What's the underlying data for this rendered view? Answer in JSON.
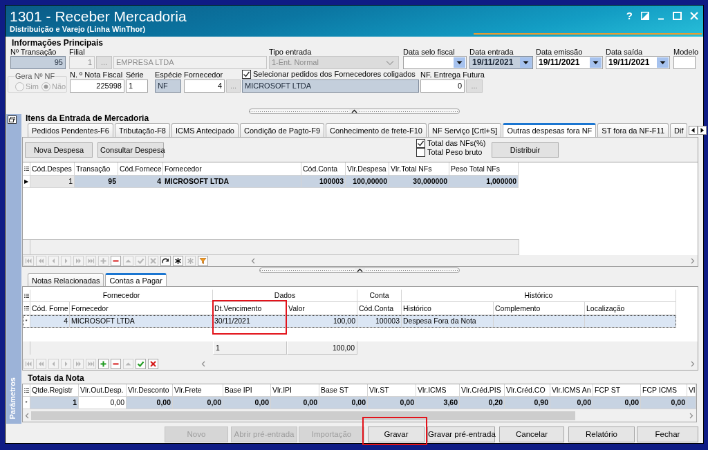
{
  "window": {
    "title": "1301 - Receber Mercadoria",
    "subtitle": "Distribuição e Varejo (Linha WinThor)",
    "help": "?"
  },
  "main_info": {
    "title": "Informações Principais",
    "row_1": [
      {
        "kind": "number",
        "label": "Nº Transação",
        "value": "95",
        "readonly": true,
        "disabled": false
      },
      {
        "kind": "lookup",
        "label": "Filial",
        "code": "1",
        "button": "...",
        "name": "EMPRESA LTDA",
        "readonly": false,
        "disabled": true
      },
      {
        "kind": "combo",
        "label": "Tipo entrada",
        "value": "1-Ent. Normal",
        "readonly": false,
        "disabled": true
      },
      {
        "kind": "date",
        "label": "Data selo fiscal",
        "readonly": false,
        "disabled": false
      },
      {
        "kind": "date",
        "label": "Data entrada",
        "value": "19/11/2021",
        "readonly": true,
        "disabled": false
      },
      {
        "kind": "date",
        "label": "Data emissão",
        "value": "19/11/2021",
        "readonly": false,
        "disabled": false
      },
      {
        "kind": "date",
        "label": "Data saída",
        "value": "19/11/2021",
        "readonly": false,
        "disabled": false
      },
      {
        "kind": "text",
        "label": "Modelo",
        "readonly": false,
        "disabled": false
      }
    ],
    "row_2": [
      {
        "kind": "radio_group",
        "label": "Gera Nº NF",
        "disabled": true,
        "options": [
          {
            "label": "Sim",
            "selected": false
          },
          {
            "label": "Não",
            "selected": true
          }
        ]
      },
      {
        "kind": "number",
        "label": "N. º Nota Fiscal",
        "value": "225998",
        "readonly": false,
        "disabled": false
      },
      {
        "kind": "text",
        "label": "Série",
        "value": "1",
        "readonly": false,
        "disabled": false
      },
      {
        "kind": "text",
        "label": "Espécie",
        "value": "NF",
        "readonly": true,
        "disabled": false
      },
      {
        "kind": "lookup",
        "label": "Fornecedor",
        "code": "4",
        "button": "...",
        "name": "MICROSOFT LTDA",
        "readonly": true,
        "disabled": false,
        "name_option": {
          "label": "Selecionar pedidos dos Fornecedores coligados",
          "checked": true
        }
      },
      {
        "kind": "lookup",
        "label": "NF. Entrega Futura",
        "code": "0",
        "button": "...",
        "disabled": false
      }
    ]
  },
  "side_panel": {
    "label": "Parâmetros"
  },
  "items": {
    "title": "Itens da Entrada de Mercadoria",
    "tabs": [
      {
        "label": "Pedidos Pendentes-F6",
        "selected": false
      },
      {
        "label": "Tributação-F8",
        "selected": false
      },
      {
        "label": "ICMS Antecipado",
        "selected": false
      },
      {
        "label": "Condição de Pagto-F9",
        "selected": false
      },
      {
        "label": "Conhecimento de frete-F10",
        "selected": false
      },
      {
        "label": "NF Serviço [Crtl+S]",
        "selected": false
      },
      {
        "label": "Outras despesas fora NF",
        "selected": true
      },
      {
        "label": "ST fora da NF-F11",
        "selected": false
      },
      {
        "label": "Dif",
        "selected": false
      }
    ],
    "actions": [
      "Nova Despesa",
      "Consultar Despesa"
    ],
    "options": [
      {
        "label": "Total das NFs(%)",
        "checked": true
      },
      {
        "label": "Total Peso bruto",
        "checked": false
      }
    ],
    "distribute_button": "Distribuir",
    "grid": {
      "columns": [
        {
          "label": "Cód.Despes",
          "kind": "number",
          "focused": true
        },
        {
          "label": "Transação",
          "kind": "number",
          "focused": false
        },
        {
          "label": "Cód.Fornece",
          "kind": "number",
          "focused": false
        },
        {
          "label": "Fornecedor",
          "kind": "text",
          "focused": false
        },
        {
          "label": "Cód.Conta",
          "kind": "number",
          "focused": false
        },
        {
          "label": "Vlr.Despesa",
          "kind": "number",
          "focused": false
        },
        {
          "label": "Vlr.Total NFs",
          "kind": "number",
          "focused": false
        },
        {
          "label": "Peso Total NFs",
          "kind": "number",
          "focused": false
        }
      ],
      "rows": [
        {
          "indicator": "▶",
          "selected": true,
          "cells": [
            "1",
            "95",
            "4",
            "MICROSOFT LTDA",
            "100003",
            "100,00000",
            "30,000000",
            "1,000000"
          ]
        }
      ]
    },
    "navigator": [
      {
        "kind": "first",
        "disabled": true
      },
      {
        "kind": "prev_page",
        "disabled": true
      },
      {
        "kind": "prev",
        "disabled": true
      },
      {
        "kind": "next",
        "disabled": true
      },
      {
        "kind": "next_page",
        "disabled": true
      },
      {
        "kind": "last",
        "disabled": true
      },
      {
        "kind": "insert",
        "disabled": true
      },
      {
        "kind": "delete",
        "disabled": false
      },
      {
        "kind": "edit",
        "disabled": true
      },
      {
        "kind": "post",
        "disabled": true
      },
      {
        "kind": "cancel",
        "disabled": true
      },
      {
        "kind": "refresh",
        "disabled": false
      },
      {
        "kind": "asterisk",
        "disabled": false
      },
      {
        "kind": "asterisk",
        "disabled": true
      },
      {
        "kind": "filter",
        "disabled": false
      }
    ]
  },
  "payables": {
    "tabs": [
      {
        "label": "Notas Relacionadas",
        "selected": false
      },
      {
        "label": "Contas a Pagar",
        "selected": true
      }
    ],
    "grid": {
      "bands": [
        {
          "label": "Fornecedor",
          "columns": [
            {
              "label": "Cód. Forne",
              "kind": "number",
              "highlighted": false
            },
            {
              "label": "Fornecedor",
              "kind": "text",
              "highlighted": false
            }
          ]
        },
        {
          "label": "Dados",
          "columns": [
            {
              "label": "Dt.Vencimento",
              "kind": "text",
              "highlighted": true,
              "summary": "1"
            },
            {
              "label": "Valor",
              "kind": "number",
              "highlighted": false,
              "summary": "100,00"
            }
          ]
        },
        {
          "label": "Conta",
          "columns": [
            {
              "label": "Cód.Conta",
              "kind": "number",
              "highlighted": false
            }
          ]
        },
        {
          "label": "Histórico",
          "columns": [
            {
              "label": "Histórico",
              "kind": "text",
              "highlighted": false
            },
            {
              "label": "Complemento",
              "kind": "text",
              "highlighted": false
            },
            {
              "label": "Localização",
              "kind": "text",
              "highlighted": false
            }
          ]
        }
      ],
      "rows": [
        {
          "indicator": "*",
          "selected": true,
          "cells": [
            "4",
            "MICROSOFT LTDA",
            "30/11/2021",
            "100,00",
            "100003",
            "Despesa Fora da Nota",
            null,
            null
          ]
        }
      ]
    },
    "navigator": [
      {
        "kind": "first",
        "disabled": true
      },
      {
        "kind": "prev_page",
        "disabled": true
      },
      {
        "kind": "prev",
        "disabled": true
      },
      {
        "kind": "next",
        "disabled": true
      },
      {
        "kind": "next_page",
        "disabled": true
      },
      {
        "kind": "last",
        "disabled": true
      },
      {
        "kind": "insert",
        "disabled": false
      },
      {
        "kind": "delete",
        "disabled": false
      },
      {
        "kind": "edit",
        "disabled": true
      },
      {
        "kind": "post",
        "disabled": false
      },
      {
        "kind": "cancel",
        "disabled": false
      }
    ]
  },
  "totals": {
    "title": "Totais da Nota",
    "grid": {
      "columns": [
        {
          "label": "Qtde.Registr",
          "kind": "number",
          "focused": false
        },
        {
          "label": "Vlr.Out.Desp.",
          "kind": "number",
          "focused": true
        },
        {
          "label": "Vlr.Desconto",
          "kind": "number",
          "focused": false
        },
        {
          "label": "Vlr.Frete",
          "kind": "number",
          "focused": false
        },
        {
          "label": "Base IPI",
          "kind": "number",
          "focused": false
        },
        {
          "label": "Vlr.IPI",
          "kind": "number",
          "focused": false
        },
        {
          "label": "Base ST",
          "kind": "number",
          "focused": false
        },
        {
          "label": "Vlr.ST",
          "kind": "number",
          "focused": false
        },
        {
          "label": "Vlr.ICMS",
          "kind": "number",
          "focused": false
        },
        {
          "label": "Vlr.Créd.PIS",
          "kind": "number",
          "focused": false
        },
        {
          "label": "Vlr.Créd.CO",
          "kind": "number",
          "focused": false
        },
        {
          "label": "Vlr.ICMS An",
          "kind": "number",
          "focused": false
        },
        {
          "label": "FCP ST",
          "kind": "number",
          "focused": false
        },
        {
          "label": "FCP ICMS",
          "kind": "number",
          "focused": false
        },
        {
          "label": "Vl",
          "kind": "number",
          "focused": false
        }
      ],
      "rows": [
        {
          "indicator": "*",
          "selected": true,
          "cells": [
            "1",
            "0,00",
            "0,00",
            "0,00",
            "0,00",
            "0,00",
            "0,00",
            "0,00",
            "3,60",
            "0,20",
            "0,90",
            "0,00",
            "0,00",
            "0,00",
            null
          ]
        }
      ]
    }
  },
  "buttons": [
    {
      "label": "Novo",
      "disabled": true,
      "highlighted": false
    },
    {
      "label": "Abrir pré-entrada",
      "disabled": true,
      "highlighted": false
    },
    {
      "label": "Importação",
      "disabled": true,
      "highlighted": false
    },
    {
      "label": "Gravar",
      "disabled": false,
      "highlighted": true
    },
    {
      "label": "Gravar pré-entrada",
      "disabled": false,
      "highlighted": false
    },
    {
      "label": "Cancelar",
      "disabled": false,
      "highlighted": false
    },
    {
      "label": "Relatório",
      "disabled": false,
      "highlighted": false
    },
    {
      "label": "Fechar",
      "disabled": false,
      "highlighted": false
    }
  ]
}
